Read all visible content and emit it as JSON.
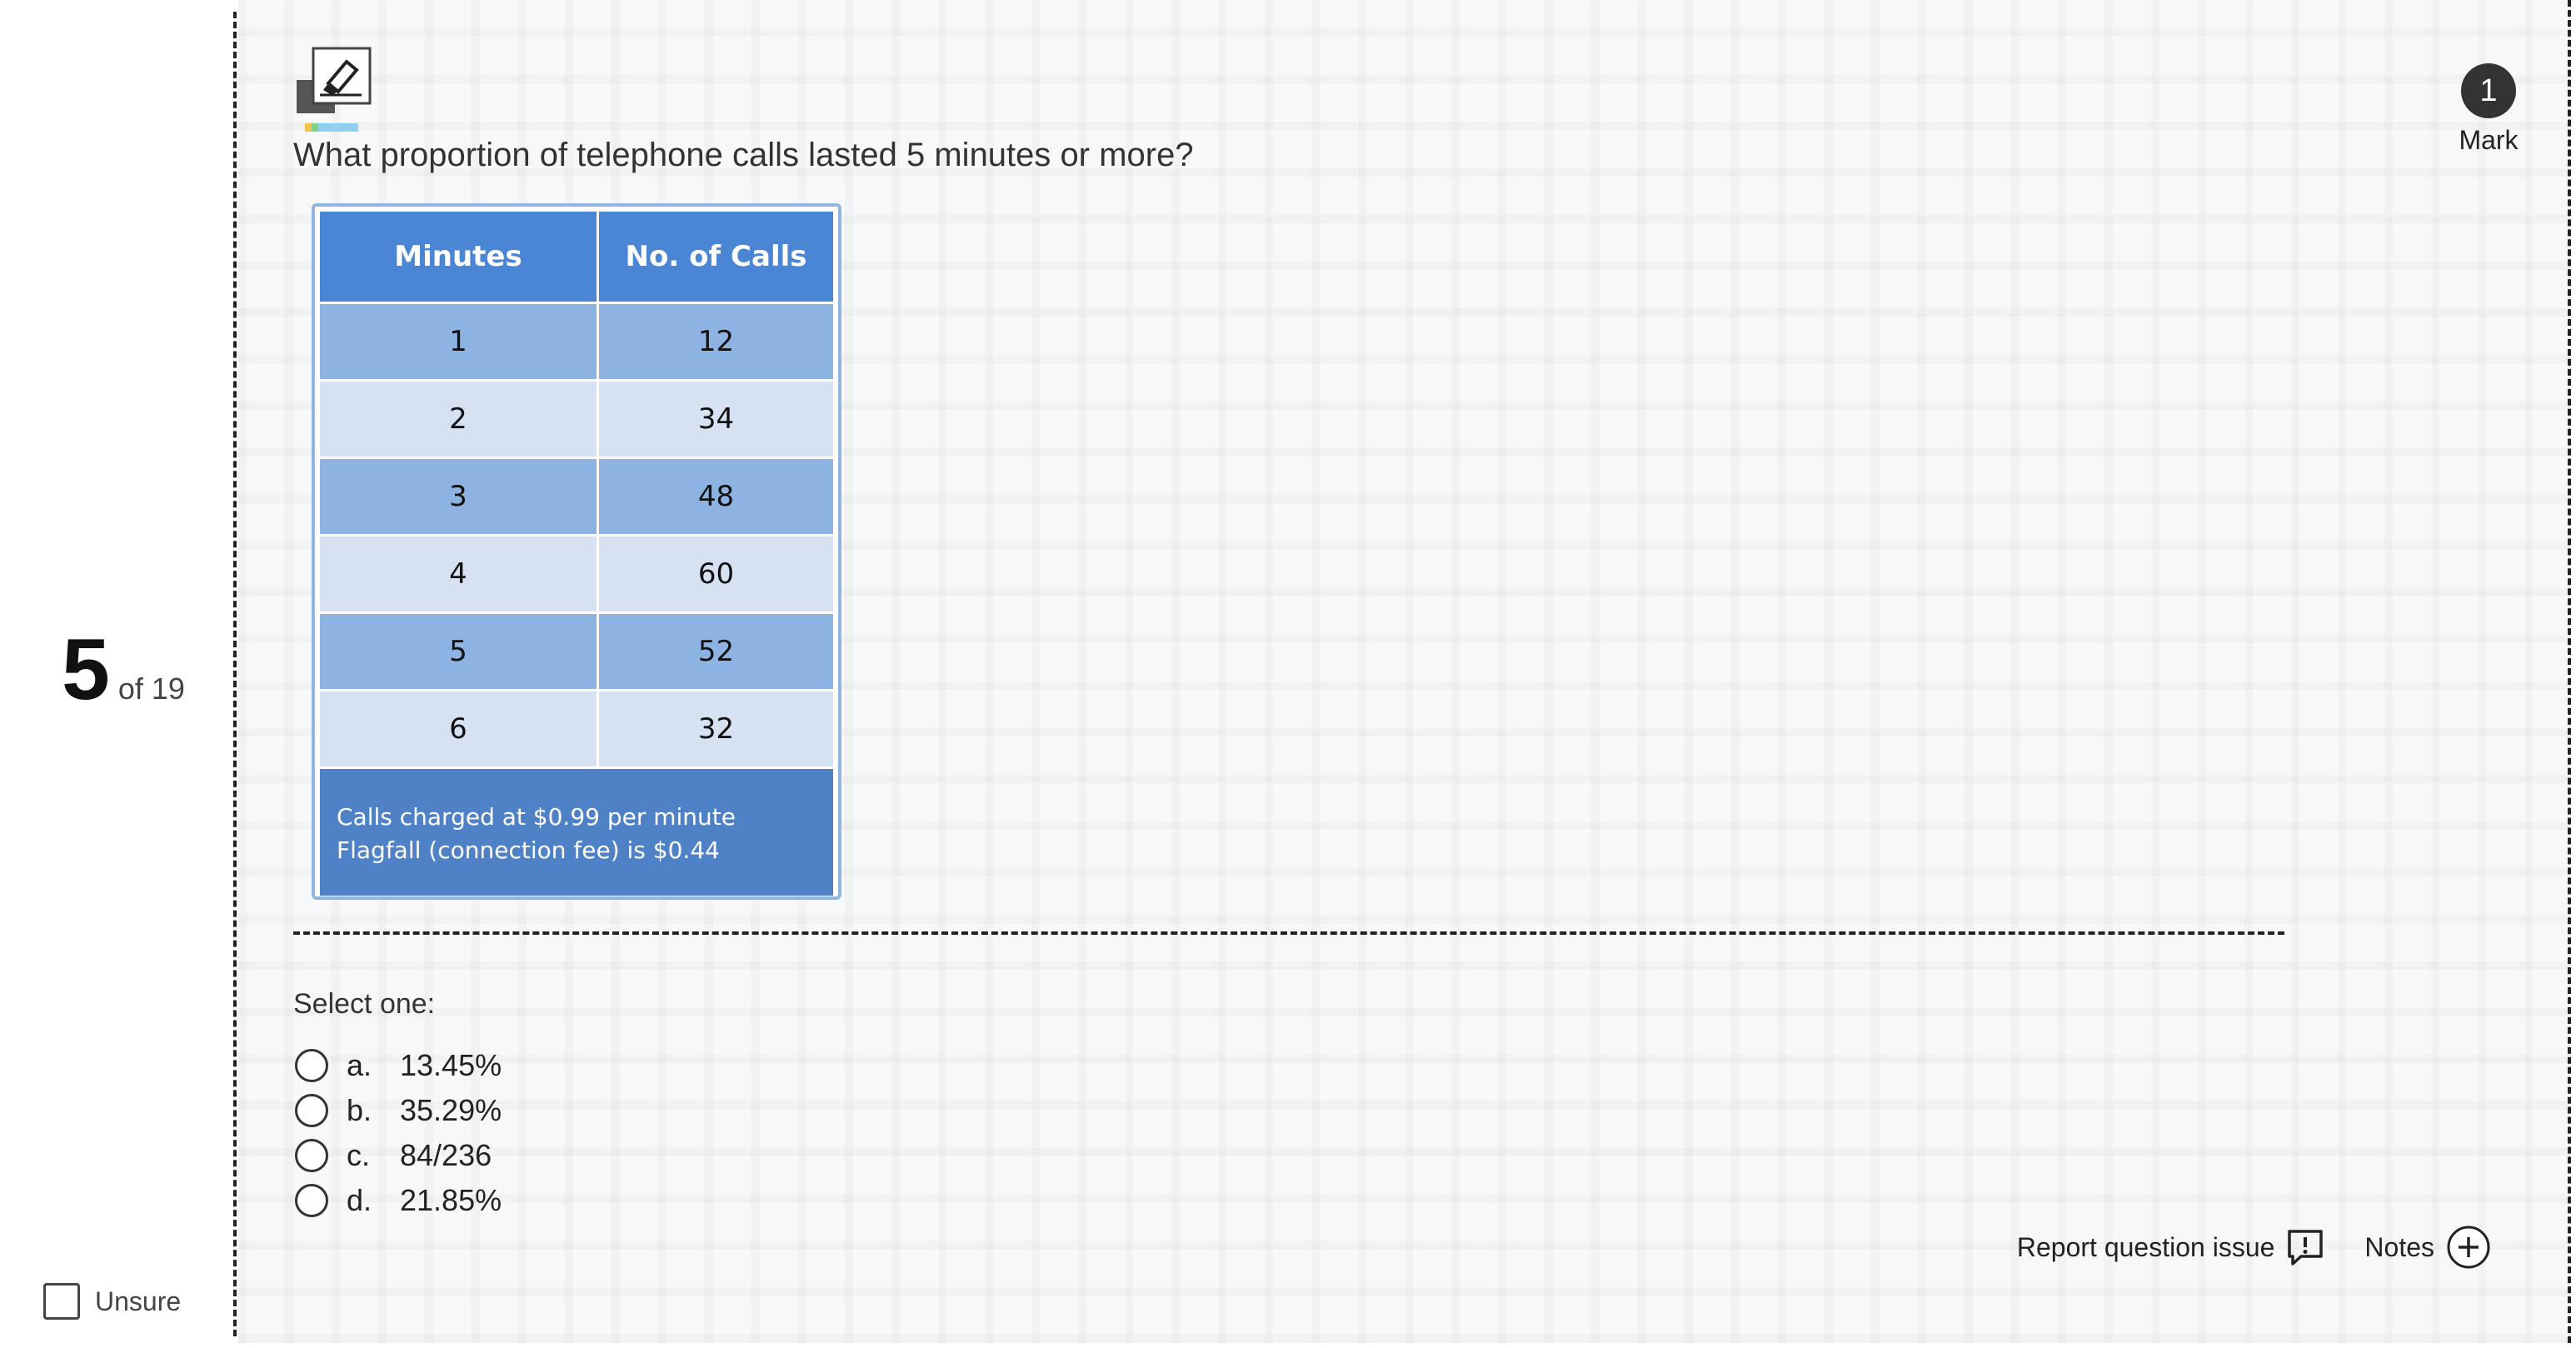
{
  "progress": {
    "current": "5",
    "of_label": "of 19"
  },
  "unsure_label": "Unsure",
  "question": {
    "text": "What proportion of telephone calls lasted 5 minutes or more?",
    "mark_count": "1",
    "mark_label": "Mark"
  },
  "table": {
    "headers": [
      "Minutes",
      "No. of Calls"
    ],
    "rows": [
      [
        "1",
        "12"
      ],
      [
        "2",
        "34"
      ],
      [
        "3",
        "48"
      ],
      [
        "4",
        "60"
      ],
      [
        "5",
        "52"
      ],
      [
        "6",
        "32"
      ]
    ],
    "footer_line1": "Calls charged at $0.99 per minute",
    "footer_line2": "Flagfall (connection fee) is $0.44"
  },
  "answers": {
    "prompt": "Select one:",
    "options": [
      {
        "letter": "a.",
        "text": "13.45%"
      },
      {
        "letter": "b.",
        "text": "35.29%"
      },
      {
        "letter": "c.",
        "text": "84/236"
      },
      {
        "letter": "d.",
        "text": "21.85%"
      }
    ]
  },
  "footer_actions": {
    "report_label": "Report question issue",
    "notes_label": "Notes"
  },
  "icons": {
    "eraser": "eraser-icon",
    "report": "report-issue-icon",
    "notes": "plus-circle-icon"
  },
  "colors": {
    "table_header": "#4a86d4",
    "table_row_dark": "#8db3e2",
    "table_row_light": "#d6e2f1",
    "table_footer": "#4f81c7"
  }
}
